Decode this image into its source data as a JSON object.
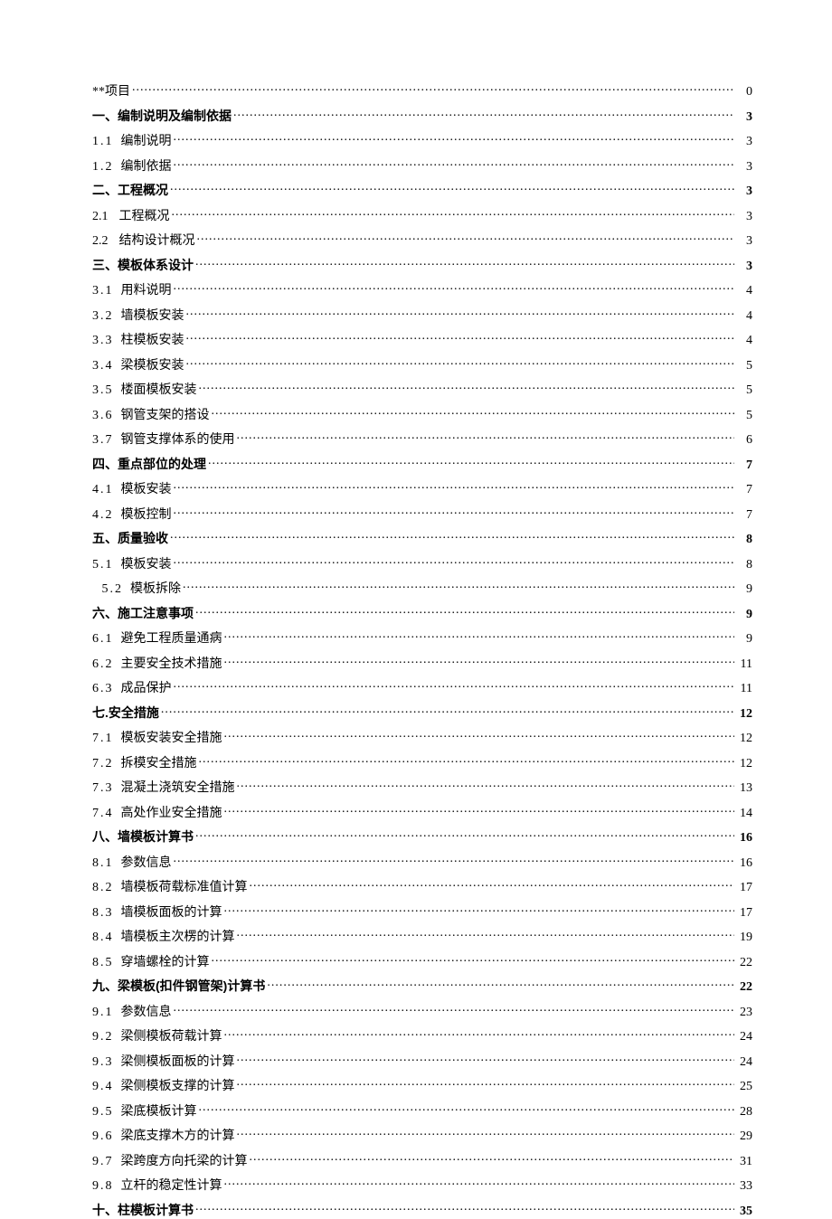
{
  "toc": [
    {
      "label": "**项目",
      "page": "0",
      "bold": false,
      "indent": 0
    },
    {
      "label": "一、编制说明及编制依据",
      "page": "3",
      "bold": true,
      "indent": 0
    },
    {
      "num": "1.1",
      "label": "编制说明",
      "page": "3",
      "bold": false,
      "indent": 0
    },
    {
      "num": "1.2",
      "label": "编制依据",
      "page": "3",
      "bold": false,
      "indent": 0
    },
    {
      "label": "二、工程概况",
      "page": "3",
      "bold": true,
      "indent": 0
    },
    {
      "num": "2.1",
      "label": "工程概况",
      "page": "3",
      "bold": false,
      "indent": 0,
      "nospace": true
    },
    {
      "num": "2.2",
      "label": "结构设计概况",
      "page": "3",
      "bold": false,
      "indent": 0,
      "nospace": true
    },
    {
      "label": "三、模板体系设计",
      "page": "3",
      "bold": true,
      "indent": 0
    },
    {
      "num": "3.1",
      "label": "用料说明",
      "page": "4",
      "bold": false,
      "indent": 0
    },
    {
      "num": "3.2",
      "label": "墙模板安装",
      "page": "4",
      "bold": false,
      "indent": 0
    },
    {
      "num": "3.3",
      "label": "柱模板安装",
      "page": "4",
      "bold": false,
      "indent": 0
    },
    {
      "num": "3.4",
      "label": "梁模板安装",
      "page": "5",
      "bold": false,
      "indent": 0
    },
    {
      "num": "3.5",
      "label": "楼面模板安装",
      "page": "5",
      "bold": false,
      "indent": 0
    },
    {
      "num": "3.6",
      "label": "钢管支架的搭设",
      "page": "5",
      "bold": false,
      "indent": 0
    },
    {
      "num": "3.7",
      "label": "钢管支撑体系的使用",
      "page": "6",
      "bold": false,
      "indent": 0
    },
    {
      "label": "四、重点部位的处理",
      "page": "7",
      "bold": true,
      "indent": 0
    },
    {
      "num": "4.1",
      "label": "模板安装",
      "page": "7",
      "bold": false,
      "indent": 0
    },
    {
      "num": "4.2",
      "label": "模板控制",
      "page": "7",
      "bold": false,
      "indent": 0
    },
    {
      "label": "五、质量验收",
      "page": "8",
      "bold": true,
      "indent": 0
    },
    {
      "num": "5.1",
      "label": "模板安装",
      "page": "8",
      "bold": false,
      "indent": 0
    },
    {
      "num": "5.2",
      "label": "模板拆除",
      "page": "9",
      "bold": false,
      "indent": 1
    },
    {
      "label": "六、施工注意事项",
      "page": "9",
      "bold": true,
      "indent": 0
    },
    {
      "num": "6.1",
      "label": "避免工程质量通病",
      "page": "9",
      "bold": false,
      "indent": 0
    },
    {
      "num": "6.2",
      "label": "主要安全技术措施",
      "page": "11",
      "bold": false,
      "indent": 0
    },
    {
      "num": "6.3",
      "label": "成品保护",
      "page": "11",
      "bold": false,
      "indent": 0
    },
    {
      "label": "七.安全措施",
      "page": "12",
      "bold": true,
      "indent": 0
    },
    {
      "num": "7.1",
      "label": "模板安装安全措施",
      "page": "12",
      "bold": false,
      "indent": 0
    },
    {
      "num": "7.2",
      "label": "拆模安全措施",
      "page": "12",
      "bold": false,
      "indent": 0
    },
    {
      "num": "7.3",
      "label": "混凝土浇筑安全措施",
      "page": "13",
      "bold": false,
      "indent": 0
    },
    {
      "num": "7.4",
      "label": "高处作业安全措施",
      "page": "14",
      "bold": false,
      "indent": 0
    },
    {
      "label": "八、墙模板计算书",
      "page": "16",
      "bold": true,
      "indent": 0
    },
    {
      "num": "8.1",
      "label": "参数信息",
      "page": "16",
      "bold": false,
      "indent": 0
    },
    {
      "num": "8.2",
      "label": "墙模板荷载标准值计算",
      "page": "17",
      "bold": false,
      "indent": 0
    },
    {
      "num": "8.3",
      "label": "墙模板面板的计算",
      "page": "17",
      "bold": false,
      "indent": 0
    },
    {
      "num": "8.4",
      "label": "墙模板主次楞的计算",
      "page": "19",
      "bold": false,
      "indent": 0
    },
    {
      "num": "8.5",
      "label": "穿墙螺栓的计算",
      "page": "22",
      "bold": false,
      "indent": 0
    },
    {
      "label": "九、梁模板(扣件钢管架)计算书",
      "page": "22",
      "bold": true,
      "indent": 0
    },
    {
      "num": "9.1",
      "label": "参数信息",
      "page": "23",
      "bold": false,
      "indent": 0
    },
    {
      "num": "9.2",
      "label": "梁侧模板荷载计算",
      "page": "24",
      "bold": false,
      "indent": 0
    },
    {
      "num": "9.3",
      "label": "梁侧模板面板的计算",
      "page": "24",
      "bold": false,
      "indent": 0
    },
    {
      "num": "9.4",
      "label": "梁侧模板支撑的计算",
      "page": "25",
      "bold": false,
      "indent": 0
    },
    {
      "num": "9.5",
      "label": "梁底模板计算",
      "page": "28",
      "bold": false,
      "indent": 0
    },
    {
      "num": "9.6",
      "label": "梁底支撑木方的计算",
      "page": "29",
      "bold": false,
      "indent": 0
    },
    {
      "num": "9.7",
      "label": "梁跨度方向托梁的计算",
      "page": "31",
      "bold": false,
      "indent": 0
    },
    {
      "num": "9.8",
      "label": "立杆的稳定性计算",
      "page": "33",
      "bold": false,
      "indent": 0
    },
    {
      "label": "十、柱模板计算书",
      "page": "35",
      "bold": true,
      "indent": 0
    }
  ]
}
